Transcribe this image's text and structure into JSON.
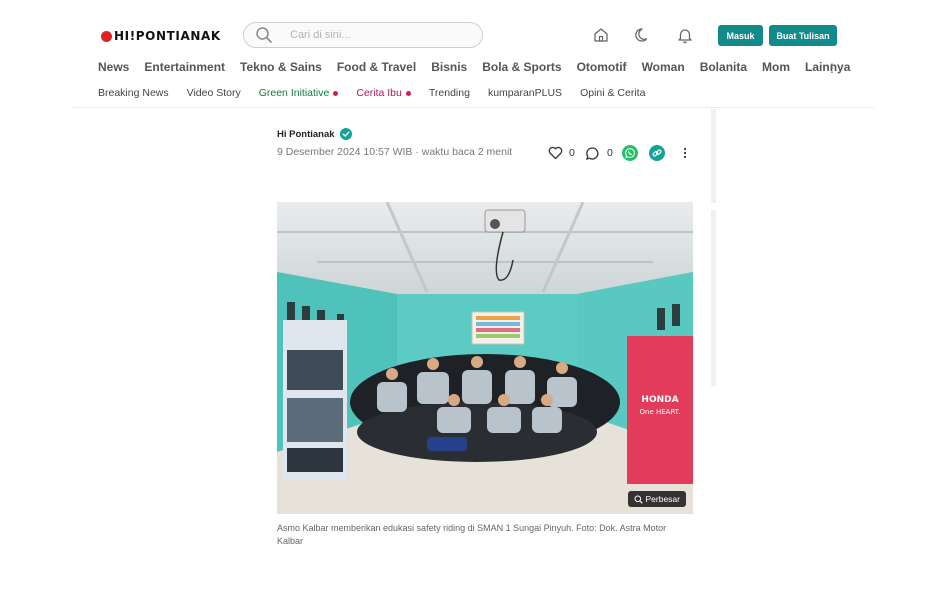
{
  "header": {
    "logo_text": "HI!PONTIANAK",
    "search_placeholder": "Cari di sini...",
    "login_label": "Masuk",
    "write_label": "Buat Tulisan",
    "icons": [
      "home-icon",
      "moon-icon",
      "bell-icon"
    ],
    "accent_color": "#138a8a",
    "brand_color": "#e31e24"
  },
  "nav_main": [
    "News",
    "Entertainment",
    "Tekno & Sains",
    "Food & Travel",
    "Bisnis",
    "Bola & Sports",
    "Otomotif",
    "Woman",
    "Bolanita",
    "Mom",
    "Lainnya"
  ],
  "nav_sub": [
    {
      "label": "Breaking News"
    },
    {
      "label": "Video Story"
    },
    {
      "label": "Green Initiative"
    },
    {
      "label": "Cerita Ibu"
    },
    {
      "label": "Trending"
    },
    {
      "label": "kumparanPLUS"
    },
    {
      "label": "Opini & Cerita"
    }
  ],
  "article": {
    "author": "Hi Pontianak",
    "meta": "9 Desember 2024 10:57 WIB · waktu baca 2 menit",
    "likes": "0",
    "comments": "0",
    "zoom_label": "Perbesar",
    "caption": "Asmo Kalbar memberikan edukasi safety riding di SMAN 1 Sungai Pinyuh. Foto: Dok. Astra Motor Kalbar",
    "banner_text_1": "HONDA",
    "banner_text_2": "One HEART."
  }
}
